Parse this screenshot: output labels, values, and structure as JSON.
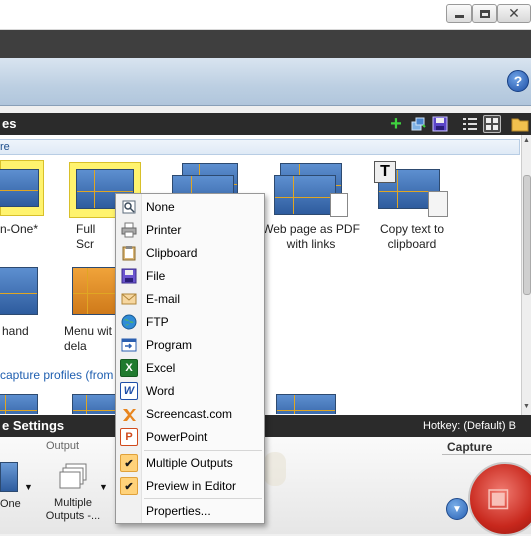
{
  "window": {
    "close_glyph": "✕"
  },
  "help": {
    "label": "?"
  },
  "profiles": {
    "header": "es",
    "group_label_1": "re",
    "group_label_2": "capture profiles (from",
    "items": [
      {
        "label": "n-One*",
        "selected": true
      },
      {
        "label": "Full Scr",
        "selected": true
      },
      {
        "label": ""
      },
      {
        "label": "Web page as PDF\nwith links"
      },
      {
        "label": "Copy text to\nclipboard"
      },
      {
        "label": "hand"
      },
      {
        "label": "Menu wit\ndela"
      }
    ]
  },
  "settings": {
    "header": "e Settings",
    "hotkey": "Hotkey: (Default) B",
    "output_caption": "Output",
    "capture_caption": "Capture",
    "one_label": "One",
    "multi_label": "Multiple\nOutputs -..."
  },
  "context_menu": {
    "items": [
      {
        "label": "None",
        "icon": "scanner-icon"
      },
      {
        "label": "Printer",
        "icon": "printer-icon"
      },
      {
        "label": "Clipboard",
        "icon": "clipboard-icon"
      },
      {
        "label": "File",
        "icon": "floppy-disk-icon"
      },
      {
        "label": "E-mail",
        "icon": "envelope-icon"
      },
      {
        "label": "FTP",
        "icon": "globe-icon"
      },
      {
        "label": "Program",
        "icon": "program-icon"
      },
      {
        "label": "Excel",
        "icon": "excel-icon"
      },
      {
        "label": "Word",
        "icon": "word-icon"
      },
      {
        "label": "Screencast.com",
        "icon": "screencast-icon"
      },
      {
        "label": "PowerPoint",
        "icon": "powerpoint-icon"
      },
      {
        "label": "Multiple Outputs",
        "icon": "checkmark-icon",
        "checked": true
      },
      {
        "label": "Preview in Editor",
        "icon": "checkmark-icon",
        "checked": true
      },
      {
        "label": "Properties...",
        "icon": ""
      }
    ]
  },
  "colors": {
    "accent": "#3f3f3f",
    "selection": "#fff36e",
    "capture": "#c8281d"
  }
}
